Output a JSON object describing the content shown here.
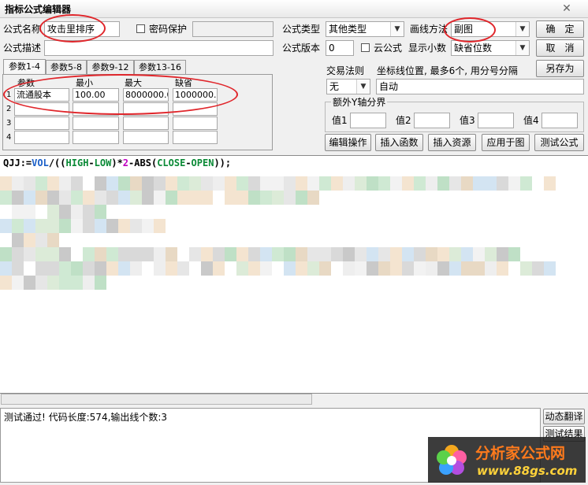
{
  "window": {
    "title": "指标公式编辑器",
    "close_glyph": "✕"
  },
  "form": {
    "name_label": "公式名称",
    "name_value": "攻击里排序",
    "password_label": "密码保护",
    "password_value": "",
    "desc_label": "公式描述",
    "desc_value": "",
    "type_label": "公式类型",
    "type_value": "其他类型",
    "draw_label": "画线方法",
    "draw_value": "副图",
    "version_label": "公式版本",
    "version_value": "0",
    "cloud_label": "云公式",
    "decimals_label": "显示小数",
    "decimals_value": "缺省位数",
    "trade_label": "交易法则",
    "trade_value": "无",
    "coord_label": "坐标线位置, 最多6个, 用分号分隔",
    "coord_value": "自动",
    "yaxis_label": "额外Y轴分界",
    "yaxis_items": [
      {
        "label": "值1",
        "value": ""
      },
      {
        "label": "值2",
        "value": ""
      },
      {
        "label": "值3",
        "value": ""
      },
      {
        "label": "值4",
        "value": ""
      }
    ]
  },
  "buttons": {
    "ok": "确　定",
    "cancel": "取　消",
    "save_as": "另存为",
    "edit_op": "编辑操作",
    "insert_fn": "插入函数",
    "insert_res": "插入资源",
    "apply_chart": "应用于图",
    "test_formula": "测试公式",
    "dyn_translate": "动态翻译",
    "test_result": "测试结果"
  },
  "tabs": [
    "参数1-4",
    "参数5-8",
    "参数9-12",
    "参数13-16"
  ],
  "params": {
    "headers": [
      "参数",
      "最小",
      "最大",
      "缺省"
    ],
    "rows": [
      {
        "num": "1",
        "name": "流通股本",
        "min": "100.00",
        "max": "8000000.0",
        "def": "1000000.0"
      },
      {
        "num": "2",
        "name": "",
        "min": "",
        "max": "",
        "def": ""
      },
      {
        "num": "3",
        "name": "",
        "min": "",
        "max": "",
        "def": ""
      },
      {
        "num": "4",
        "name": "",
        "min": "",
        "max": "",
        "def": ""
      }
    ]
  },
  "code": {
    "line1_parts": [
      {
        "t": "QJJ",
        "c": "var"
      },
      {
        "t": ":=",
        "c": "var"
      },
      {
        "t": "VOL",
        "c": "fn"
      },
      {
        "t": "/((",
        "c": "var"
      },
      {
        "t": "HIGH",
        "c": "id"
      },
      {
        "t": "-",
        "c": "var"
      },
      {
        "t": "LOW",
        "c": "id"
      },
      {
        "t": ")*",
        "c": "var"
      },
      {
        "t": "2",
        "c": "num"
      },
      {
        "t": "-",
        "c": "var"
      },
      {
        "t": "ABS",
        "c": "var"
      },
      {
        "t": "(",
        "c": "var"
      },
      {
        "t": "CLOSE",
        "c": "id"
      },
      {
        "t": "-",
        "c": "var"
      },
      {
        "t": "OPEN",
        "c": "id"
      },
      {
        "t": "));",
        "c": "var"
      }
    ]
  },
  "status": {
    "message": "测试通过! 代码长度:574,输出线个数:3"
  },
  "watermark": {
    "brand": "分析家公式网",
    "url": "www.88gs.com"
  }
}
